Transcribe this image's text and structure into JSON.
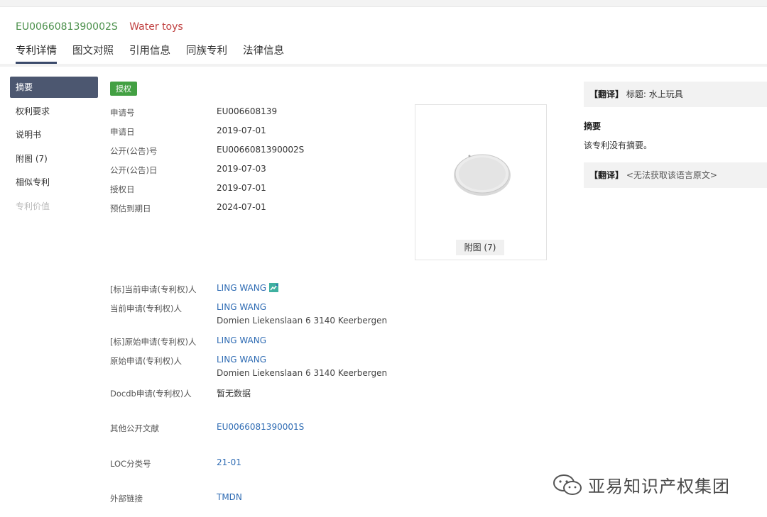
{
  "header": {
    "publication_number": "EU0066081390002S",
    "title": "Water toys"
  },
  "tabs": [
    {
      "label": "专利详情",
      "active": true
    },
    {
      "label": "图文对照"
    },
    {
      "label": "引用信息"
    },
    {
      "label": "同族专利"
    },
    {
      "label": "法律信息"
    }
  ],
  "side_nav": [
    {
      "label": "摘要",
      "active": true
    },
    {
      "label": "权利要求"
    },
    {
      "label": "说明书"
    },
    {
      "label": "附图 (7)"
    },
    {
      "label": "相似专利"
    },
    {
      "label": "专利价值",
      "disabled": true
    }
  ],
  "status": "授权",
  "fields": {
    "application_number": {
      "label": "申请号",
      "value": "EU006608139"
    },
    "application_date": {
      "label": "申请日",
      "value": "2019-07-01"
    },
    "publication_number": {
      "label": "公开(公告)号",
      "value": "EU0066081390002S"
    },
    "publication_date": {
      "label": "公开(公告)日",
      "value": "2019-07-03"
    },
    "grant_date": {
      "label": "授权日",
      "value": "2019-07-01"
    },
    "expiry_date": {
      "label": "预估到期日",
      "value": "2024-07-01"
    },
    "std_current_applicant": {
      "label": "[标]当前申请(专利权)人",
      "value": "LING WANG"
    },
    "current_applicant": {
      "label": "当前申请(专利权)人",
      "value": "LING WANG",
      "address": "Domien Liekenslaan 6 3140 Keerbergen"
    },
    "std_original_applicant": {
      "label": "[标]原始申请(专利权)人",
      "value": "LING WANG"
    },
    "original_applicant": {
      "label": "原始申请(专利权)人",
      "value": "LING WANG",
      "address": "Domien Liekenslaan 6 3140 Keerbergen"
    },
    "docdb_applicant": {
      "label": "Docdb申请(专利权)人",
      "value": "暂无数据"
    },
    "other_publications": {
      "label": "其他公开文献",
      "value": "EU0066081390001S"
    },
    "loc_class": {
      "label": "LOC分类号",
      "value": "21-01"
    },
    "external_links": {
      "label": "外部链接",
      "value": "TMDN"
    }
  },
  "figure": {
    "caption": "附图 (7)"
  },
  "right_panel": {
    "translate_tag": "【翻译】",
    "title_label": "标题: 水上玩具",
    "abstract_heading": "摘要",
    "abstract_text": "该专利没有摘要。",
    "original_text": "<无法获取该语言原文>"
  },
  "watermark": {
    "text": "亚易知识产权集团"
  },
  "colors": {
    "accent_nav": "#4c5770",
    "badge_green": "#43a043",
    "link_blue": "#2e6bb3",
    "pub_number_green": "#4a8f4a",
    "title_red": "#c04040"
  }
}
